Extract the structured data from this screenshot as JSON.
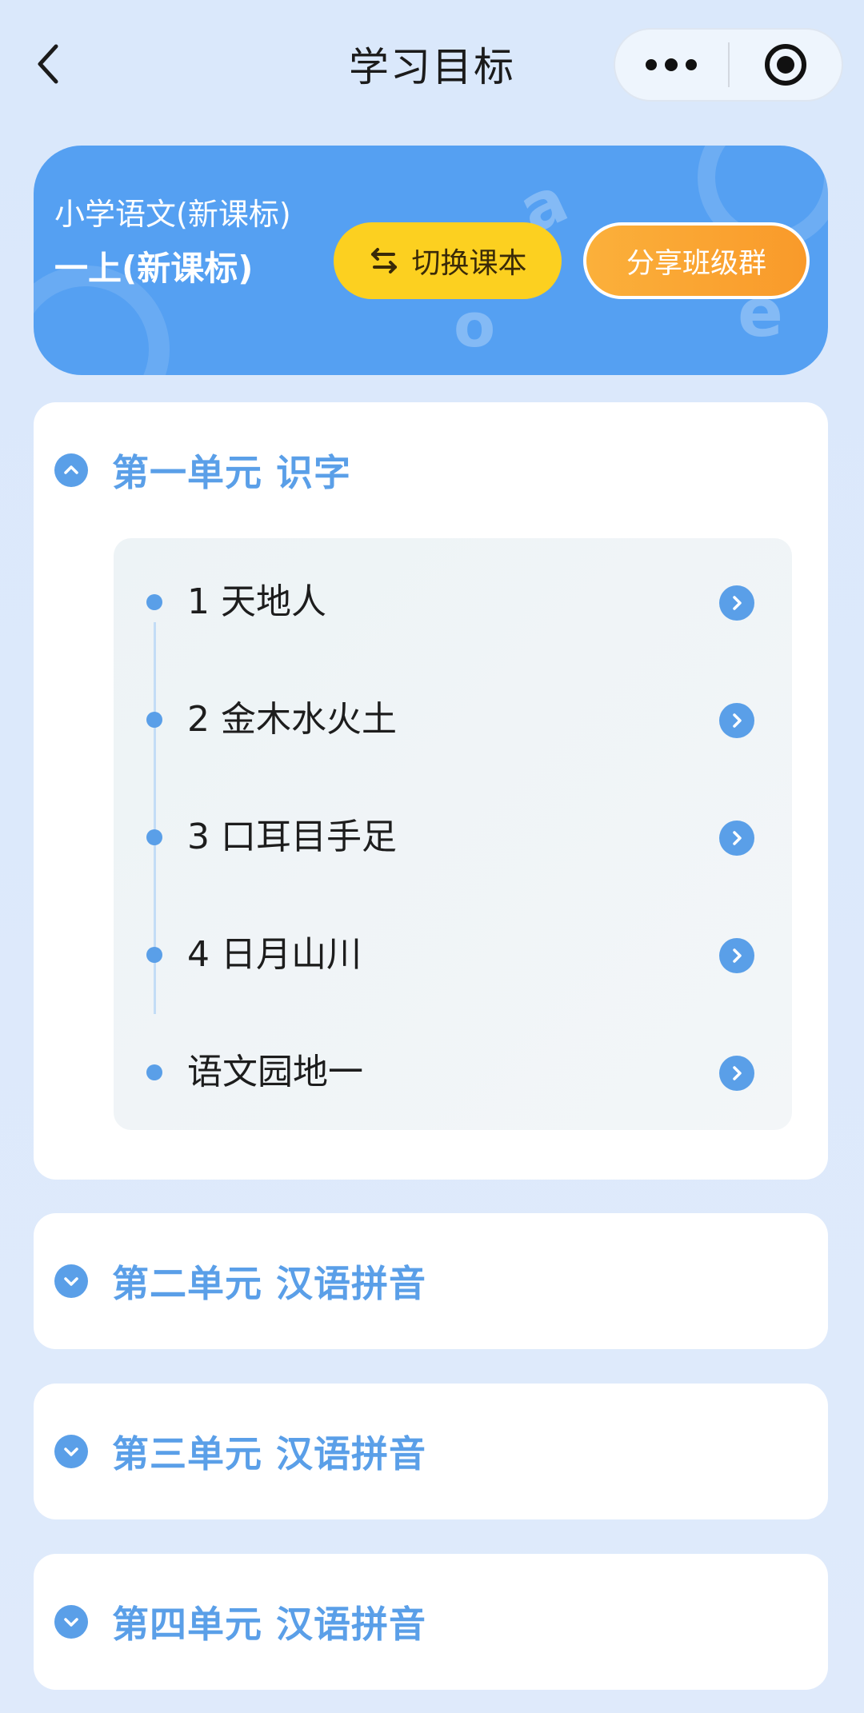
{
  "nav": {
    "title": "学习目标",
    "back_icon": "chevron-left-icon",
    "more_icon": "more-dots-icon",
    "close_icon": "target-circle-icon"
  },
  "banner": {
    "course": "小学语文(新课标)",
    "grade": "一上(新课标)",
    "switch_label": "切换课本",
    "switch_icon": "swap-arrows-icon",
    "share_label": "分享班级群"
  },
  "units": [
    {
      "title": "第一单元 识字",
      "expanded": true,
      "lessons": [
        {
          "label": "1 天地人"
        },
        {
          "label": "2 金木水火土"
        },
        {
          "label": "3 口耳目手足"
        },
        {
          "label": "4 日月山川"
        },
        {
          "label": "语文园地一"
        }
      ]
    },
    {
      "title": "第二单元 汉语拼音",
      "expanded": false
    },
    {
      "title": "第三单元 汉语拼音",
      "expanded": false
    },
    {
      "title": "第四单元 汉语拼音",
      "expanded": false
    }
  ],
  "colors": {
    "accent": "#5a9fe8",
    "banner": "#55a0f2",
    "switch_button": "#fcd020",
    "share_button": "#f99a2a",
    "page_bg": "#dce9fb"
  }
}
